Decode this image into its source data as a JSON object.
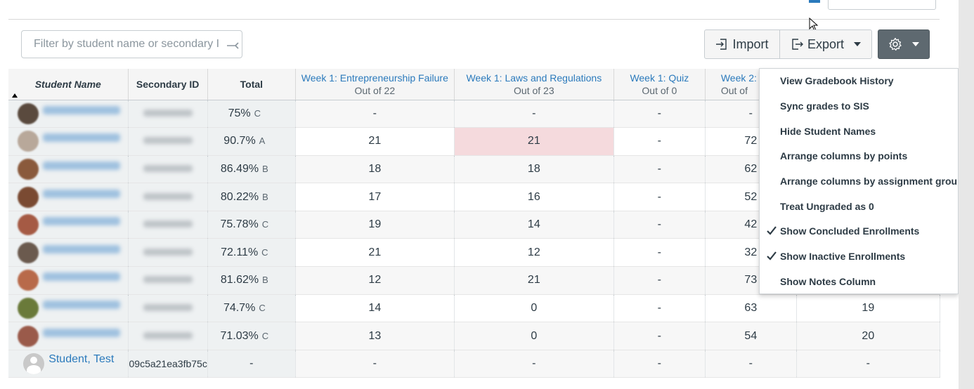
{
  "filter": {
    "placeholder": "Filter by student name or secondary ID"
  },
  "toolbar": {
    "import_label": "Import",
    "export_label": "Export"
  },
  "columns": {
    "student": "Student Name",
    "secondary": "Secondary ID",
    "total": "Total",
    "assignments": [
      {
        "name": "Week 1: Entrepreneurship Failure",
        "sub": "Out of 22"
      },
      {
        "name": "Week 1: Laws and Regulations",
        "sub": "Out of 23"
      },
      {
        "name": "Week 1: Quiz",
        "sub": "Out of 0"
      },
      {
        "name": "Week 2:",
        "sub": "Out of"
      }
    ]
  },
  "rows": [
    {
      "total": "75%",
      "letter": "C",
      "a1": "-",
      "a2": "-",
      "a3": "-",
      "a4": "-",
      "a5": ""
    },
    {
      "total": "90.7%",
      "letter": "A",
      "a1": "21",
      "a2": "21",
      "a3": "-",
      "a4": "72",
      "a5": ""
    },
    {
      "total": "86.49%",
      "letter": "B",
      "a1": "18",
      "a2": "18",
      "a3": "-",
      "a4": "62",
      "a5": ""
    },
    {
      "total": "80.22%",
      "letter": "B",
      "a1": "17",
      "a2": "16",
      "a3": "-",
      "a4": "52",
      "a5": ""
    },
    {
      "total": "75.78%",
      "letter": "C",
      "a1": "19",
      "a2": "14",
      "a3": "-",
      "a4": "42",
      "a5": ""
    },
    {
      "total": "72.11%",
      "letter": "C",
      "a1": "21",
      "a2": "12",
      "a3": "-",
      "a4": "32",
      "a5": ""
    },
    {
      "total": "81.62%",
      "letter": "B",
      "a1": "12",
      "a2": "21",
      "a3": "-",
      "a4": "73",
      "a5": ""
    },
    {
      "total": "74.7%",
      "letter": "C",
      "a1": "14",
      "a2": "0",
      "a3": "-",
      "a4": "63",
      "a5": "19"
    },
    {
      "total": "71.03%",
      "letter": "C",
      "a1": "13",
      "a2": "0",
      "a3": "-",
      "a4": "54",
      "a5": "20"
    }
  ],
  "test_row": {
    "name": "Student, Test",
    "secondary": "09c5a21ea3fb75c",
    "total": "-",
    "a1": "-",
    "a2": "-",
    "a3": "-",
    "a4": "-",
    "a5": "-"
  },
  "menu": {
    "items": [
      {
        "label": "View Gradebook History",
        "checked": false
      },
      {
        "label": "Sync grades to SIS",
        "checked": false
      },
      {
        "label": "Hide Student Names",
        "checked": false
      },
      {
        "label": "Arrange columns by points",
        "checked": false
      },
      {
        "label": "Arrange columns by assignment group",
        "checked": false
      },
      {
        "label": "Treat Ungraded as 0",
        "checked": false
      },
      {
        "label": "Show Concluded Enrollments",
        "checked": true
      },
      {
        "label": "Show Inactive Enrollments",
        "checked": true
      },
      {
        "label": "Show Notes Column",
        "checked": false
      }
    ]
  },
  "colors": {
    "link": "#2b7abc",
    "highlight": "#f5dadd",
    "gear_button": "#5e6970"
  }
}
